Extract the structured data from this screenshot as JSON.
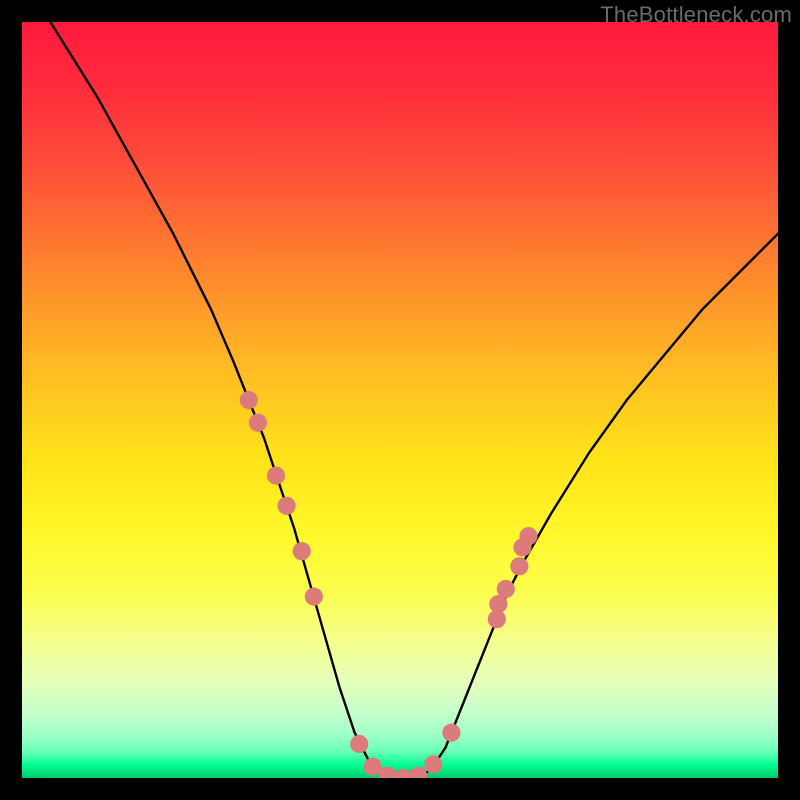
{
  "watermark": {
    "text": "TheBottleneck.com"
  },
  "chart_data": {
    "type": "line",
    "title": "",
    "xlabel": "",
    "ylabel": "",
    "xlim": [
      0,
      100
    ],
    "ylim": [
      0,
      100
    ],
    "grid": false,
    "series": [
      {
        "name": "bottleneck-curve",
        "x": [
          0,
          5,
          10,
          15,
          20,
          25,
          28,
          30,
          32,
          34,
          36,
          38,
          40,
          42,
          44,
          46,
          48,
          50,
          52,
          54,
          56,
          58,
          60,
          62,
          64,
          66,
          70,
          75,
          80,
          85,
          90,
          95,
          100
        ],
        "y": [
          106,
          98,
          90,
          81,
          72,
          62,
          55,
          50,
          45,
          39,
          33,
          26,
          19,
          12,
          6,
          2,
          0,
          0,
          0,
          1,
          4,
          9,
          14,
          19,
          24,
          28,
          35,
          43,
          50,
          56,
          62,
          67,
          72
        ]
      }
    ],
    "markers": {
      "name": "curve-markers",
      "color": "#db7b7b",
      "radius_pct": 1.2,
      "points": [
        {
          "x": 30.0,
          "y": 50.0
        },
        {
          "x": 31.2,
          "y": 47.0
        },
        {
          "x": 33.6,
          "y": 40.0
        },
        {
          "x": 35.0,
          "y": 36.0
        },
        {
          "x": 37.0,
          "y": 30.0
        },
        {
          "x": 38.6,
          "y": 24.0
        },
        {
          "x": 44.6,
          "y": 4.5
        },
        {
          "x": 46.4,
          "y": 1.5
        },
        {
          "x": 48.4,
          "y": 0.3
        },
        {
          "x": 50.4,
          "y": 0.0
        },
        {
          "x": 52.4,
          "y": 0.3
        },
        {
          "x": 54.4,
          "y": 1.8
        },
        {
          "x": 56.8,
          "y": 6.0
        },
        {
          "x": 62.8,
          "y": 21.0
        },
        {
          "x": 63.0,
          "y": 23.0
        },
        {
          "x": 64.0,
          "y": 25.0
        },
        {
          "x": 65.8,
          "y": 28.0
        },
        {
          "x": 66.2,
          "y": 30.5
        },
        {
          "x": 67.0,
          "y": 32.0
        }
      ]
    },
    "gradient_stops": [
      {
        "pct": 0,
        "color": "#ff1a3d"
      },
      {
        "pct": 8,
        "color": "#ff2a3d"
      },
      {
        "pct": 18,
        "color": "#ff4a3a"
      },
      {
        "pct": 30,
        "color": "#ff7a30"
      },
      {
        "pct": 45,
        "color": "#ffb824"
      },
      {
        "pct": 58,
        "color": "#ffe41a"
      },
      {
        "pct": 68,
        "color": "#fff82a"
      },
      {
        "pct": 76,
        "color": "#fcff54"
      },
      {
        "pct": 82,
        "color": "#f4ff8e"
      },
      {
        "pct": 87,
        "color": "#e6ffb8"
      },
      {
        "pct": 91,
        "color": "#c8ffca"
      },
      {
        "pct": 94,
        "color": "#a4ffc8"
      },
      {
        "pct": 96.5,
        "color": "#6affb8"
      },
      {
        "pct": 98.3,
        "color": "#00ff90"
      },
      {
        "pct": 99,
        "color": "#00e880"
      },
      {
        "pct": 100,
        "color": "#00c86e"
      }
    ]
  }
}
